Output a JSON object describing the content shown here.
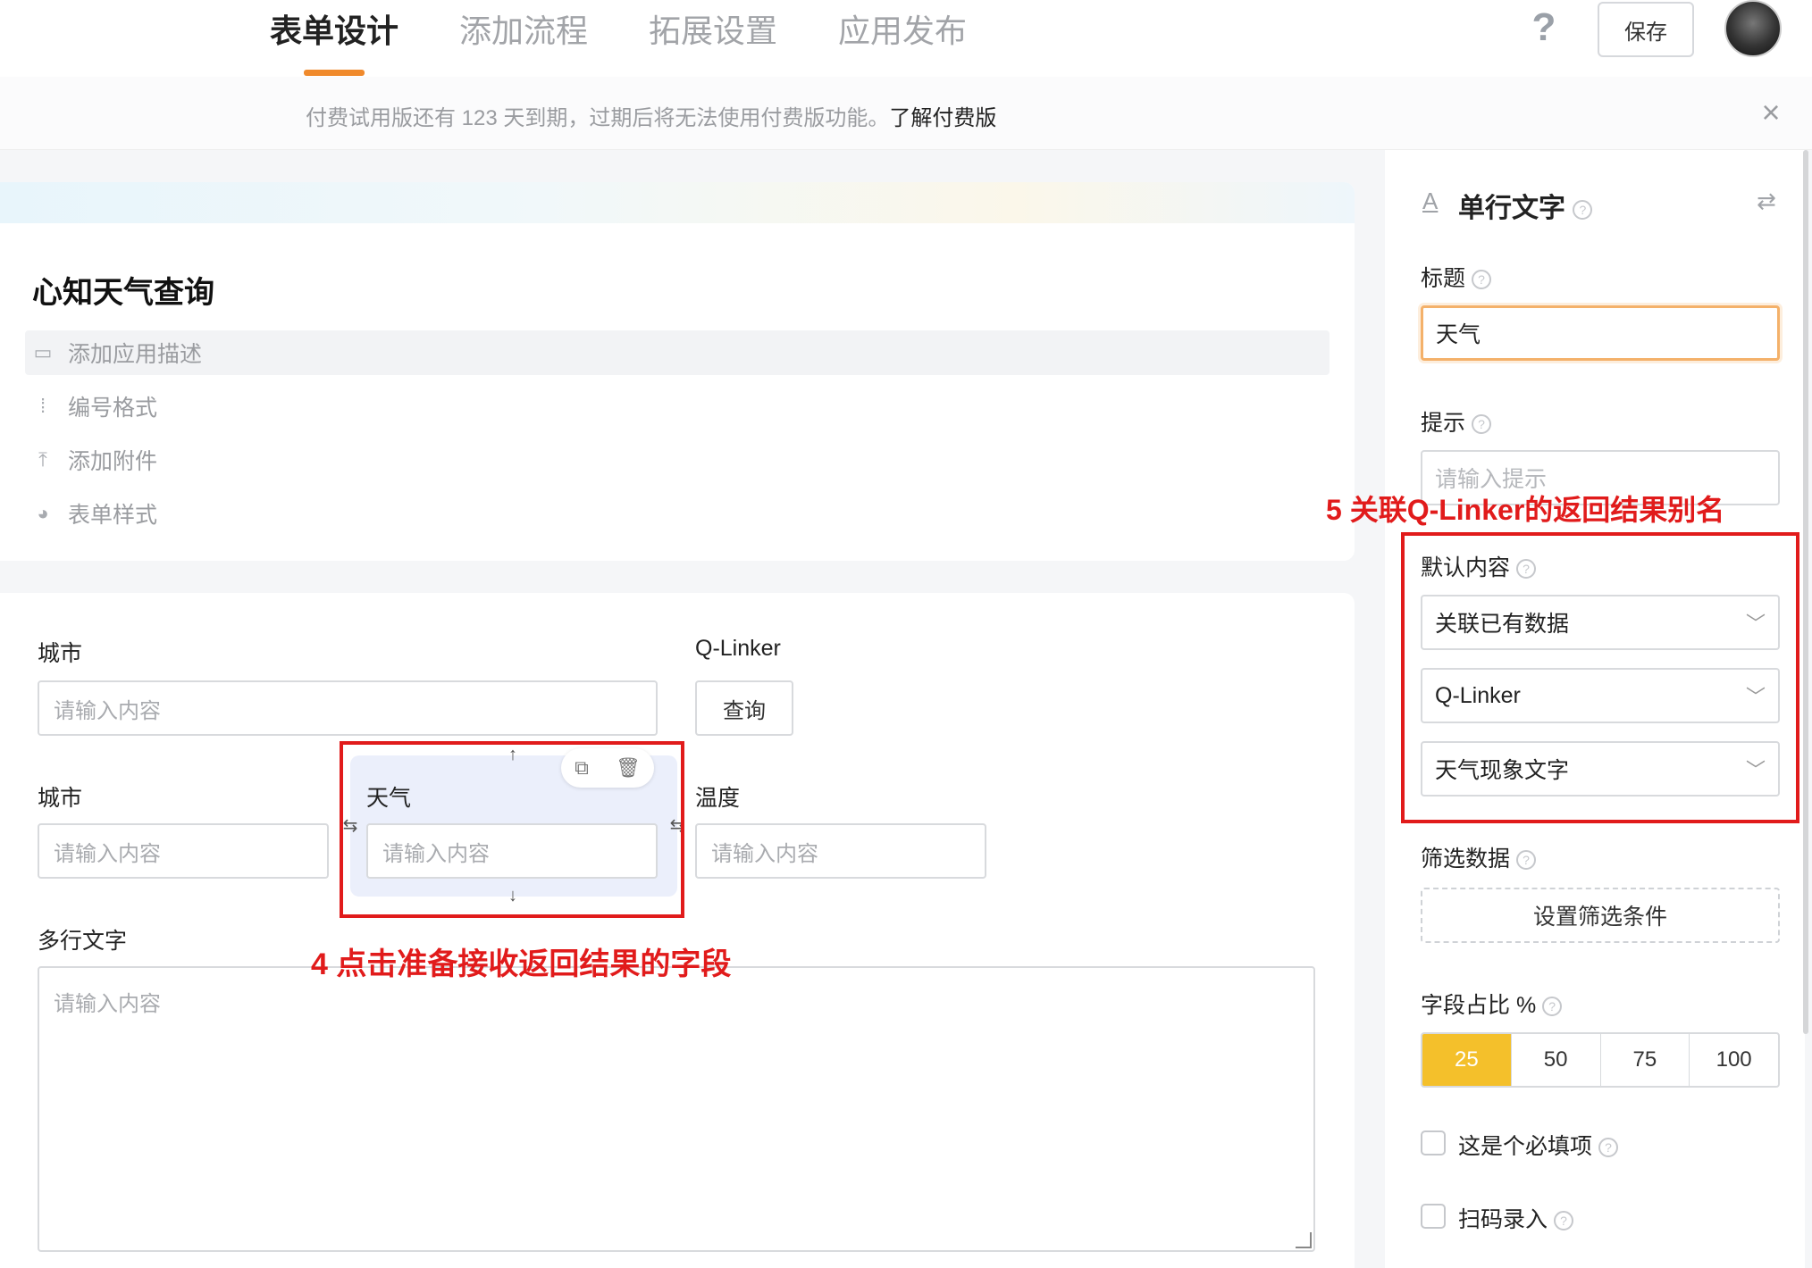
{
  "header": {
    "tabs": [
      "表单设计",
      "添加流程",
      "拓展设置",
      "应用发布"
    ],
    "help_icon": "?",
    "save_label": "保存"
  },
  "banner": {
    "text": "付费试用版还有 123 天到期，过期后将无法使用付费版功能。",
    "link": "了解付费版",
    "close": "×"
  },
  "app": {
    "title": "心知天气查询",
    "menu": [
      {
        "label": "添加应用描述",
        "icon": "comment-icon"
      },
      {
        "label": "编号格式",
        "icon": "numbering-icon"
      },
      {
        "label": "添加附件",
        "icon": "upload-icon"
      },
      {
        "label": "表单样式",
        "icon": "palette-icon"
      }
    ]
  },
  "form": {
    "row1": {
      "city_label": "城市",
      "city_placeholder": "请输入内容",
      "linker_label": "Q-Linker",
      "query_label": "查询"
    },
    "row2": {
      "city_label": "城市",
      "city_placeholder": "请输入内容",
      "weather_label": "天气",
      "weather_placeholder": "请输入内容",
      "temp_label": "温度",
      "temp_placeholder": "请输入内容"
    },
    "multiline_label": "多行文字",
    "multiline_placeholder": "请输入内容"
  },
  "annotations": {
    "step4": "4 点击准备接收返回结果的字段",
    "step5": "5 关联Q-Linker的返回结果别名"
  },
  "panel": {
    "title": "单行文字",
    "title_label": "标题",
    "title_value": "天气",
    "tip_label": "提示",
    "tip_placeholder": "请输入提示",
    "default_label": "默认内容",
    "default_selects": [
      "关联已有数据",
      "Q-Linker",
      "天气现象文字"
    ],
    "filter_label": "筛选数据",
    "filter_button": "设置筛选条件",
    "ratio_label": "字段占比 %",
    "ratios": [
      "25",
      "50",
      "75",
      "100"
    ],
    "ratio_selected": "25",
    "required_label": "这是个必填项",
    "scan_label": "扫码录入"
  },
  "colors": {
    "accent": "#f08a2c",
    "ratio_active": "#f4c02b",
    "annotation_red": "#e11b1b"
  }
}
